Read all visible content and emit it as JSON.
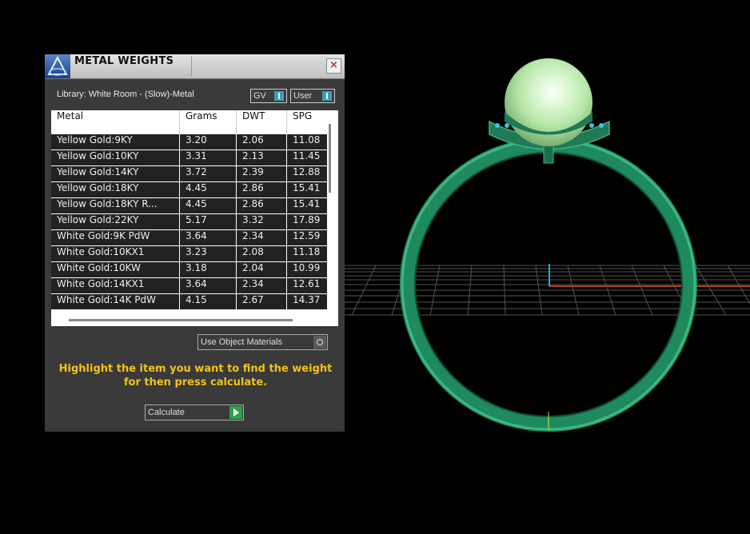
{
  "panel": {
    "title": "METAL WEIGHTS",
    "library_label": "Library: White Room - (Slow)-Metal",
    "toggles": [
      {
        "label": "GV"
      },
      {
        "label": "User"
      }
    ],
    "table": {
      "headers": [
        "Metal",
        "Grams",
        "DWT",
        "SPG"
      ],
      "rows": [
        [
          "Yellow Gold:9KY",
          "3.20",
          "2.06",
          "11.08"
        ],
        [
          "Yellow Gold:10KY",
          "3.31",
          "2.13",
          "11.45"
        ],
        [
          "Yellow Gold:14KY",
          "3.72",
          "2.39",
          "12.88"
        ],
        [
          "Yellow Gold:18KY",
          "4.45",
          "2.86",
          "15.41"
        ],
        [
          "Yellow Gold:18KY R...",
          "4.45",
          "2.86",
          "15.41"
        ],
        [
          "Yellow Gold:22KY",
          "5.17",
          "3.32",
          "17.89"
        ],
        [
          "White Gold:9K PdW",
          "3.64",
          "2.34",
          "12.59"
        ],
        [
          "White Gold:10KX1",
          "3.23",
          "2.08",
          "11.18"
        ],
        [
          "White Gold:10KW",
          "3.18",
          "2.04",
          "10.99"
        ],
        [
          "White Gold:14KX1",
          "3.64",
          "2.34",
          "12.61"
        ],
        [
          "White Gold:14K PdW",
          "4.15",
          "2.67",
          "14.37"
        ]
      ]
    },
    "use_object_materials": "Use Object Materials",
    "instruction": "Highlight the item you want to find the weight for then press calculate.",
    "calculate_label": "Calculate"
  },
  "colors": {
    "ring": "#1e8a5e",
    "pearl": "#c9f3b9",
    "accent_text": "#f2c21a",
    "gem": "#3ec7d8"
  },
  "icons": [
    "app-logo-icon",
    "close-icon",
    "toggle-icon",
    "radio-icon",
    "play-icon"
  ]
}
